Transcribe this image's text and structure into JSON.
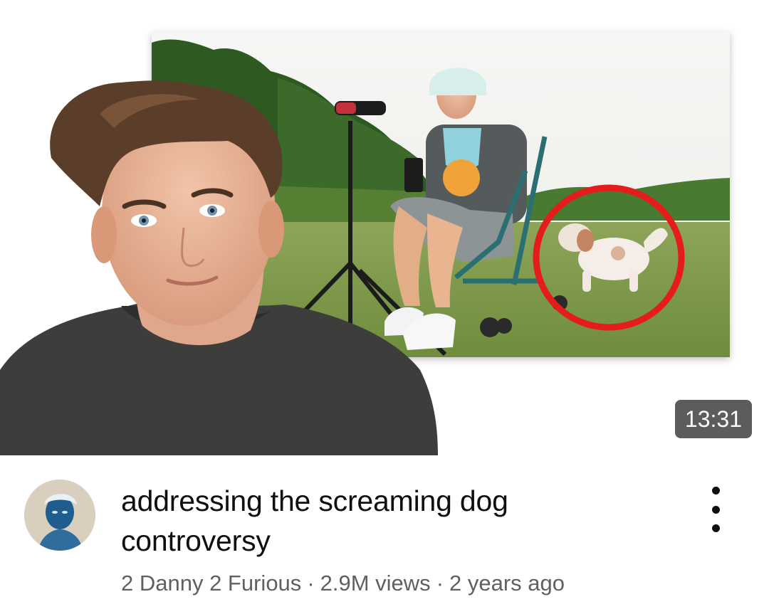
{
  "video": {
    "duration": "13:31",
    "title": "addressing the screaming dog controversy",
    "channel": "2 Danny 2 Furious",
    "views": "2.9M views",
    "age": "2 years ago",
    "separator": "·"
  },
  "icons": {
    "more": "more-vert-icon",
    "avatar": "channel-avatar"
  },
  "colors": {
    "title": "#0f0f0f",
    "meta": "#606060",
    "badge_bg": "#464646",
    "highlight_circle": "#e51b1b"
  }
}
